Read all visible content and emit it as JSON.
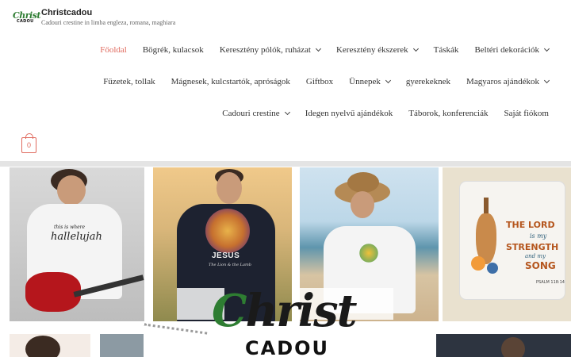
{
  "site": {
    "title": "Christcadou",
    "tagline": "Cadouri crestine in limba engleza, romana, maghiara",
    "logo_top": "Christ",
    "logo_bottom": "CADOU"
  },
  "nav": {
    "row1": [
      {
        "label": "Főoldal",
        "active": true,
        "has_dropdown": false
      },
      {
        "label": "Bögrék, kulacsok",
        "active": false,
        "has_dropdown": false
      },
      {
        "label": "Keresztény pólók, ruházat",
        "active": false,
        "has_dropdown": true
      },
      {
        "label": "Keresztény ékszerek",
        "active": false,
        "has_dropdown": true
      },
      {
        "label": "Táskák",
        "active": false,
        "has_dropdown": false
      },
      {
        "label": "Beltéri dekorációk",
        "active": false,
        "has_dropdown": true
      }
    ],
    "row2": [
      {
        "label": "Füzetek, tollak",
        "active": false,
        "has_dropdown": false
      },
      {
        "label": "Mágnesek, kulcstartók, apróságok",
        "active": false,
        "has_dropdown": false
      },
      {
        "label": "Giftbox",
        "active": false,
        "has_dropdown": false
      },
      {
        "label": "Ünnepek",
        "active": false,
        "has_dropdown": true
      },
      {
        "label": "gyerekeknek",
        "active": false,
        "has_dropdown": false
      },
      {
        "label": "Magyaros ajándékok",
        "active": false,
        "has_dropdown": true
      }
    ],
    "row3": [
      {
        "label": "Cadouri crestine",
        "active": false,
        "has_dropdown": true
      },
      {
        "label": "Idegen nyelvű ajándékok",
        "active": false,
        "has_dropdown": false
      },
      {
        "label": "Táborok, konferenciák",
        "active": false,
        "has_dropdown": false
      },
      {
        "label": "Saját fiókom",
        "active": false,
        "has_dropdown": false
      }
    ]
  },
  "cart": {
    "count": "0"
  },
  "hero": {
    "tile1_print_line1": "this is where",
    "tile1_print_line2": "hallelujah",
    "tile2_print": "JESUS",
    "tile2_print_small": "The Lion & the Lamb",
    "tile4_line1": "THE LORD",
    "tile4_line2": "is my",
    "tile4_line3": "STRENGTH",
    "tile4_line4": "and my",
    "tile4_line5": "SONG",
    "tile4_verse": "PSALM 118:14",
    "overlay_logo_1a": "C",
    "overlay_logo_1b": "hrist",
    "overlay_logo_2": "CADOU"
  },
  "colors": {
    "accent": "#e06a5e",
    "logo_green": "#2e7d32",
    "divider": "#e4e4e4"
  }
}
